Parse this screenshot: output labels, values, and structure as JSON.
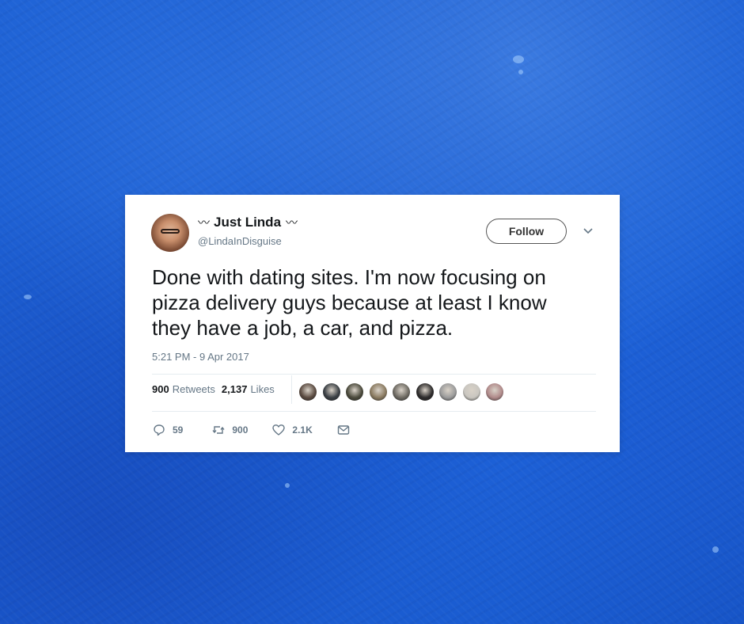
{
  "tweet": {
    "user": {
      "display_name": "Just Linda",
      "name_decoration_left": "〰",
      "name_decoration_right": "〰",
      "handle": "@LindaInDisguise",
      "avatar_icon": "profile-photo-avatar"
    },
    "follow_label": "Follow",
    "caret_icon": "chevron-down-icon",
    "text": "Done with dating sites. I'm now focusing on\npizza delivery guys because at least I know\nthey have a job, a car, and pizza.",
    "timestamp": "5:21 PM - 9 Apr 2017",
    "stats": {
      "retweets_count": "900",
      "retweets_label": "Retweets",
      "likes_count": "2,137",
      "likes_label": "Likes"
    },
    "liker_avatars": [
      {
        "color": "#5a4a40"
      },
      {
        "color": "#3a3f44"
      },
      {
        "color": "#4b4a3c"
      },
      {
        "color": "#8a7a60"
      },
      {
        "color": "#6e6a62"
      },
      {
        "color": "#2d2b2b"
      },
      {
        "color": "#9b9b9b"
      },
      {
        "color": "#c9c6c0"
      },
      {
        "color": "#b08a8a"
      }
    ],
    "actions": {
      "replies": "59",
      "retweets": "900",
      "likes": "2.1K"
    }
  },
  "colors": {
    "background": "#1a5bd0",
    "card": "#ffffff",
    "text_primary": "#14171a",
    "text_secondary": "#657786",
    "divider": "#e6ecf0"
  }
}
